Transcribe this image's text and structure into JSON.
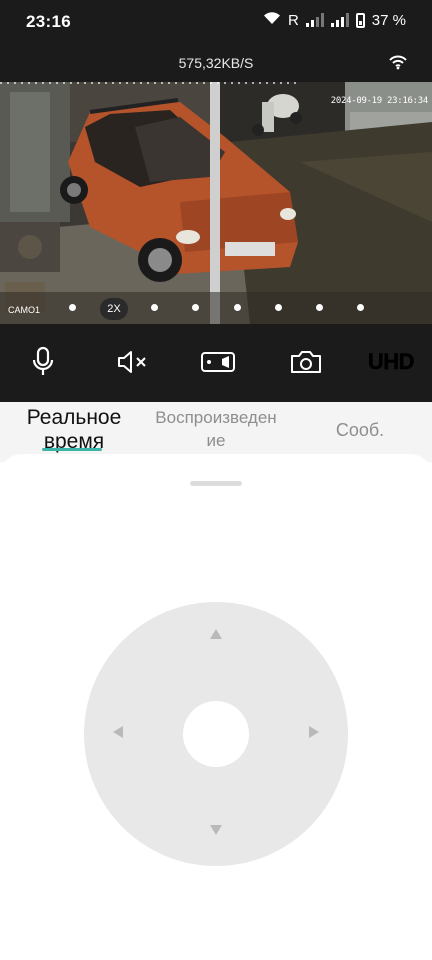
{
  "status_bar": {
    "time": "23:16",
    "roaming": "R",
    "battery": "37 %"
  },
  "stream": {
    "bitrate": "575,32KB/S"
  },
  "video": {
    "timestamp": "2024-09-19 23:16:34",
    "osd_label": "CAMO1",
    "zoom_label": "2X",
    "zoom_steps": 8
  },
  "controls": {
    "microphone_icon": "microphone-icon",
    "mute_icon": "speaker-muted-icon",
    "record_icon": "video-record-icon",
    "snapshot_icon": "camera-icon",
    "quality_label": "UHD"
  },
  "tabs": {
    "live": "Реальное время",
    "playback_line1": "Воспроизведен",
    "playback_line2": "ие",
    "messages": "Сооб.",
    "active": "live"
  },
  "ptz": {
    "up_icon": "triangle-up-icon",
    "down_icon": "triangle-down-icon",
    "left_icon": "triangle-left-icon",
    "right_icon": "triangle-right-icon"
  },
  "colors": {
    "header_bg": "#1b1b1b",
    "accent": "#3bb5a8",
    "dpad_bg": "#e8e8e8",
    "tab_active": "#111111",
    "tab_inactive": "#8e8e8e"
  }
}
